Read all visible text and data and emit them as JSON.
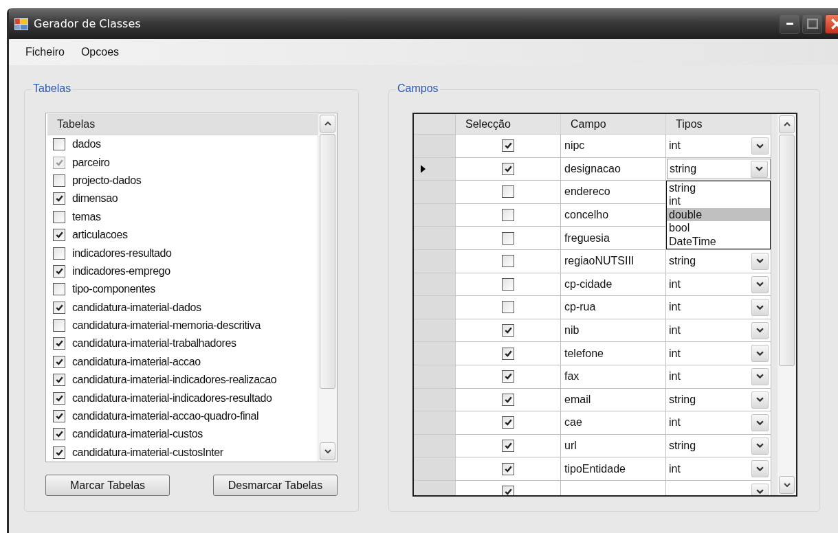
{
  "window": {
    "title": "Gerador de Classes"
  },
  "menu": [
    "Ficheiro",
    "Opcoes"
  ],
  "tables_group": {
    "title": "Tabelas",
    "list_header": "Tabelas",
    "items": [
      {
        "label": "dados",
        "checked": false,
        "disabled": false
      },
      {
        "label": "parceiro",
        "checked": true,
        "disabled": true
      },
      {
        "label": "projecto-dados",
        "checked": false,
        "disabled": false
      },
      {
        "label": "dimensao",
        "checked": true,
        "disabled": false
      },
      {
        "label": "temas",
        "checked": false,
        "disabled": false
      },
      {
        "label": "articulacoes",
        "checked": true,
        "disabled": false
      },
      {
        "label": "indicadores-resultado",
        "checked": false,
        "disabled": false
      },
      {
        "label": "indicadores-emprego",
        "checked": true,
        "disabled": false
      },
      {
        "label": "tipo-componentes",
        "checked": false,
        "disabled": false
      },
      {
        "label": "candidatura-imaterial-dados",
        "checked": true,
        "disabled": false
      },
      {
        "label": "candidatura-imaterial-memoria-descritiva",
        "checked": false,
        "disabled": false
      },
      {
        "label": "candidatura-imaterial-trabalhadores",
        "checked": true,
        "disabled": false
      },
      {
        "label": "candidatura-imaterial-accao",
        "checked": true,
        "disabled": false
      },
      {
        "label": "candidatura-imaterial-indicadores-realizacao",
        "checked": true,
        "disabled": false
      },
      {
        "label": "candidatura-imaterial-indicadores-resultado",
        "checked": true,
        "disabled": false
      },
      {
        "label": "candidatura-imaterial-accao-quadro-final",
        "checked": true,
        "disabled": false
      },
      {
        "label": "candidatura-imaterial-custos",
        "checked": true,
        "disabled": false
      },
      {
        "label": "candidatura-imaterial-custosInter",
        "checked": true,
        "disabled": false
      }
    ],
    "buttons": [
      "Marcar Tabelas",
      "Desmarcar Tabelas"
    ]
  },
  "fields_group": {
    "title": "Campos",
    "columns": [
      "Selecção",
      "Campo",
      "Tipos"
    ],
    "rows": [
      {
        "checked": true,
        "campo": "nipc",
        "tipo": "int",
        "current": false
      },
      {
        "checked": true,
        "campo": "designacao",
        "tipo": "string",
        "current": true,
        "dropdown": [
          {
            "label": "string",
            "selected": false
          },
          {
            "label": "int",
            "selected": false
          },
          {
            "label": "double",
            "selected": true
          },
          {
            "label": "bool",
            "selected": false
          },
          {
            "label": "DateTime",
            "selected": false
          }
        ]
      },
      {
        "checked": false,
        "campo": "endereco",
        "current": false
      },
      {
        "checked": false,
        "campo": "concelho",
        "current": false
      },
      {
        "checked": false,
        "campo": "freguesia",
        "current": false
      },
      {
        "checked": false,
        "campo": "regiaoNUTSIII",
        "tipo": "string",
        "current": false
      },
      {
        "checked": false,
        "campo": "cp-cidade",
        "tipo": "int",
        "current": false
      },
      {
        "checked": false,
        "campo": "cp-rua",
        "tipo": "int",
        "current": false
      },
      {
        "checked": true,
        "campo": "nib",
        "tipo": "int",
        "current": false
      },
      {
        "checked": true,
        "campo": "telefone",
        "tipo": "int",
        "current": false
      },
      {
        "checked": true,
        "campo": "fax",
        "tipo": "int",
        "current": false
      },
      {
        "checked": true,
        "campo": "email",
        "tipo": "string",
        "current": false
      },
      {
        "checked": true,
        "campo": "cae",
        "tipo": "int",
        "current": false
      },
      {
        "checked": true,
        "campo": "url",
        "tipo": "string",
        "current": false
      },
      {
        "checked": true,
        "campo": "tipoEntidade",
        "tipo": "int",
        "current": false
      },
      {
        "checked": true,
        "current": false
      }
    ]
  }
}
